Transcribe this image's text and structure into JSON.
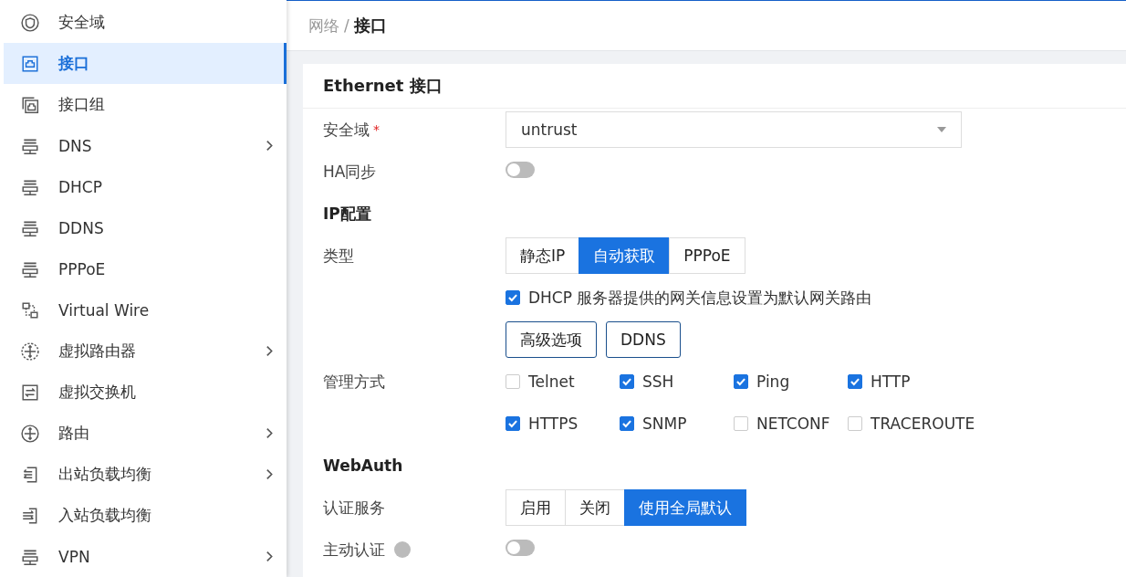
{
  "sidebar": {
    "items": [
      {
        "label": "安全域",
        "selected": false,
        "expandable": false
      },
      {
        "label": "接口",
        "selected": true,
        "expandable": false
      },
      {
        "label": "接口组",
        "selected": false,
        "expandable": false
      },
      {
        "label": "DNS",
        "selected": false,
        "expandable": true
      },
      {
        "label": "DHCP",
        "selected": false,
        "expandable": false
      },
      {
        "label": "DDNS",
        "selected": false,
        "expandable": false
      },
      {
        "label": "PPPoE",
        "selected": false,
        "expandable": false
      },
      {
        "label": "Virtual Wire",
        "selected": false,
        "expandable": false
      },
      {
        "label": "虚拟路由器",
        "selected": false,
        "expandable": true
      },
      {
        "label": "虚拟交换机",
        "selected": false,
        "expandable": false
      },
      {
        "label": "路由",
        "selected": false,
        "expandable": true
      },
      {
        "label": "出站负载均衡",
        "selected": false,
        "expandable": true
      },
      {
        "label": "入站负载均衡",
        "selected": false,
        "expandable": false
      },
      {
        "label": "VPN",
        "selected": false,
        "expandable": true
      }
    ]
  },
  "breadcrumb": {
    "parent": "网络",
    "separator": "/",
    "current": "接口"
  },
  "card": {
    "title": "Ethernet 接口",
    "rows": [
      {
        "kind": "select",
        "label": "安全域",
        "required_mark": "*",
        "value": "untrust"
      },
      {
        "kind": "toggle",
        "label": "HA同步",
        "on": false
      },
      {
        "kind": "section",
        "label": "IP配置"
      },
      {
        "kind": "segmented",
        "label": "类型",
        "options": [
          {
            "label": "静态IP",
            "selected": false
          },
          {
            "label": "自动获取",
            "selected": true
          },
          {
            "label": "PPPoE",
            "selected": false
          }
        ]
      },
      {
        "kind": "checkbox",
        "label": "DHCP 服务器提供的网关信息设置为默认网关路由",
        "checked": true
      },
      {
        "kind": "buttons",
        "buttons": [
          "高级选项",
          "DDNS"
        ]
      },
      {
        "kind": "checkgrid",
        "label": "管理方式",
        "options": [
          {
            "label": "Telnet",
            "checked": false
          },
          {
            "label": "SSH",
            "checked": true
          },
          {
            "label": "Ping",
            "checked": true
          },
          {
            "label": "HTTP",
            "checked": true
          },
          {
            "label": "HTTPS",
            "checked": true
          },
          {
            "label": "SNMP",
            "checked": true
          },
          {
            "label": "NETCONF",
            "checked": false
          },
          {
            "label": "TRACEROUTE",
            "checked": false
          }
        ]
      },
      {
        "kind": "section",
        "label": "WebAuth"
      },
      {
        "kind": "segmented",
        "label": "认证服务",
        "options": [
          {
            "label": "启用",
            "selected": false
          },
          {
            "label": "关闭",
            "selected": false
          },
          {
            "label": "使用全局默认",
            "selected": true
          }
        ]
      },
      {
        "kind": "info-toggle",
        "label": "主动认证",
        "on": false
      }
    ]
  }
}
